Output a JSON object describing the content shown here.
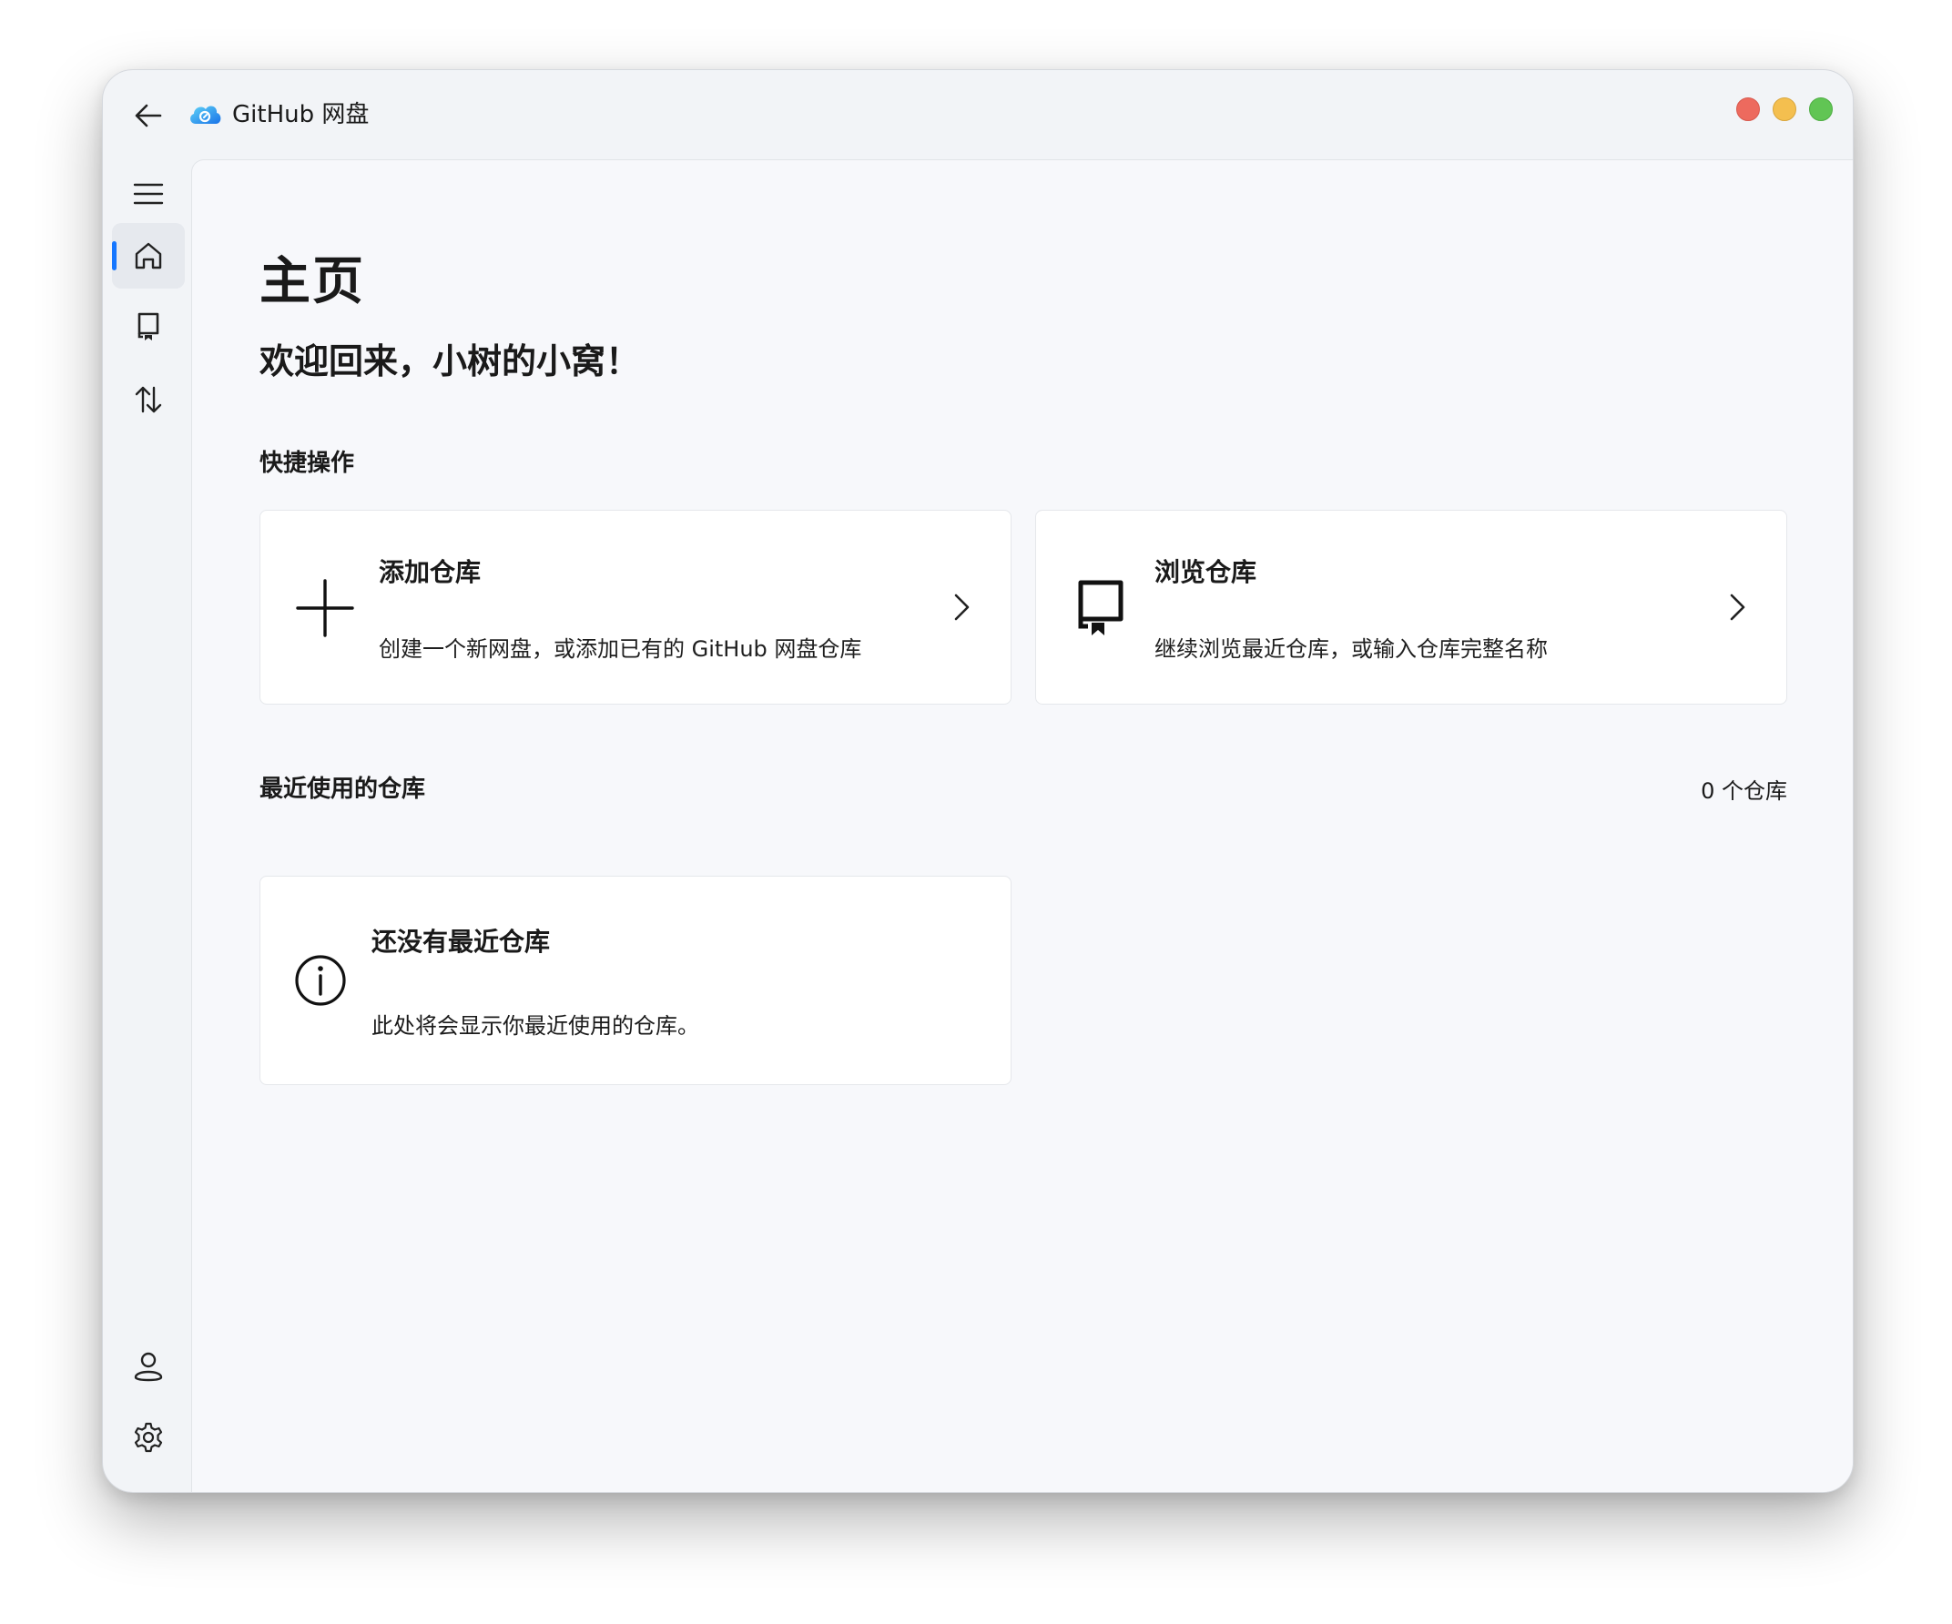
{
  "app": {
    "title": "GitHub 网盘"
  },
  "sidebar": {
    "items": [
      {
        "name": "menu",
        "icon": "hamburger-menu-icon"
      },
      {
        "name": "home",
        "icon": "home-icon",
        "active": true
      },
      {
        "name": "repository",
        "icon": "repository-icon"
      },
      {
        "name": "transfer",
        "icon": "transfer-arrows-icon"
      },
      {
        "name": "account",
        "icon": "user-icon"
      },
      {
        "name": "settings",
        "icon": "gear-icon"
      }
    ]
  },
  "main": {
    "page_title": "主页",
    "welcome": "欢迎回来，小树的小窝！",
    "quick_actions": {
      "title": "快捷操作",
      "cards": [
        {
          "icon": "plus-icon",
          "title": "添加仓库",
          "description": "创建一个新网盘，或添加已有的 GitHub 网盘仓库"
        },
        {
          "icon": "repository-icon",
          "title": "浏览仓库",
          "description": "继续浏览最近仓库，或输入仓库完整名称"
        }
      ]
    },
    "recent": {
      "title": "最近使用的仓库",
      "count_label": "0 个仓库",
      "empty": {
        "icon": "info-icon",
        "title": "还没有最近仓库",
        "description": "此处将会显示你最近使用的仓库。"
      }
    }
  },
  "colors": {
    "accent": "#1677ff",
    "close": "#ed6a5e",
    "minimize": "#f4bf4f",
    "maximize": "#61c554"
  }
}
